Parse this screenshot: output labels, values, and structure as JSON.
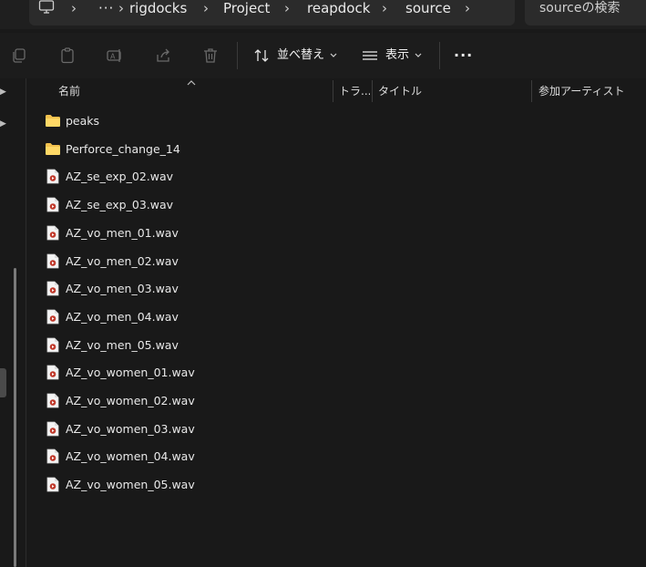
{
  "breadcrumb": {
    "more": "···",
    "items": [
      "rigdocks",
      "Project",
      "reapdock",
      "source"
    ]
  },
  "search": {
    "placeholder": "sourceの検索"
  },
  "toolbar": {
    "sort_label": "並べ替え",
    "view_label": "表示",
    "more_label": "···"
  },
  "columns": {
    "name": "名前",
    "track": "トラ...",
    "title": "タイトル",
    "artist": "参加アーティスト"
  },
  "files": [
    {
      "name": "peaks",
      "type": "folder"
    },
    {
      "name": "Perforce_change_14",
      "type": "folder"
    },
    {
      "name": "AZ_se_exp_02.wav",
      "type": "wav"
    },
    {
      "name": "AZ_se_exp_03.wav",
      "type": "wav"
    },
    {
      "name": "AZ_vo_men_01.wav",
      "type": "wav"
    },
    {
      "name": "AZ_vo_men_02.wav",
      "type": "wav"
    },
    {
      "name": "AZ_vo_men_03.wav",
      "type": "wav"
    },
    {
      "name": "AZ_vo_men_04.wav",
      "type": "wav"
    },
    {
      "name": "AZ_vo_men_05.wav",
      "type": "wav"
    },
    {
      "name": "AZ_vo_women_01.wav",
      "type": "wav"
    },
    {
      "name": "AZ_vo_women_02.wav",
      "type": "wav"
    },
    {
      "name": "AZ_vo_women_03.wav",
      "type": "wav"
    },
    {
      "name": "AZ_vo_women_04.wav",
      "type": "wav"
    },
    {
      "name": "AZ_vo_women_05.wav",
      "type": "wav"
    }
  ],
  "colors": {
    "background": "#191919",
    "folder": "#f2c14e",
    "wav_accent": "#c0392b"
  }
}
